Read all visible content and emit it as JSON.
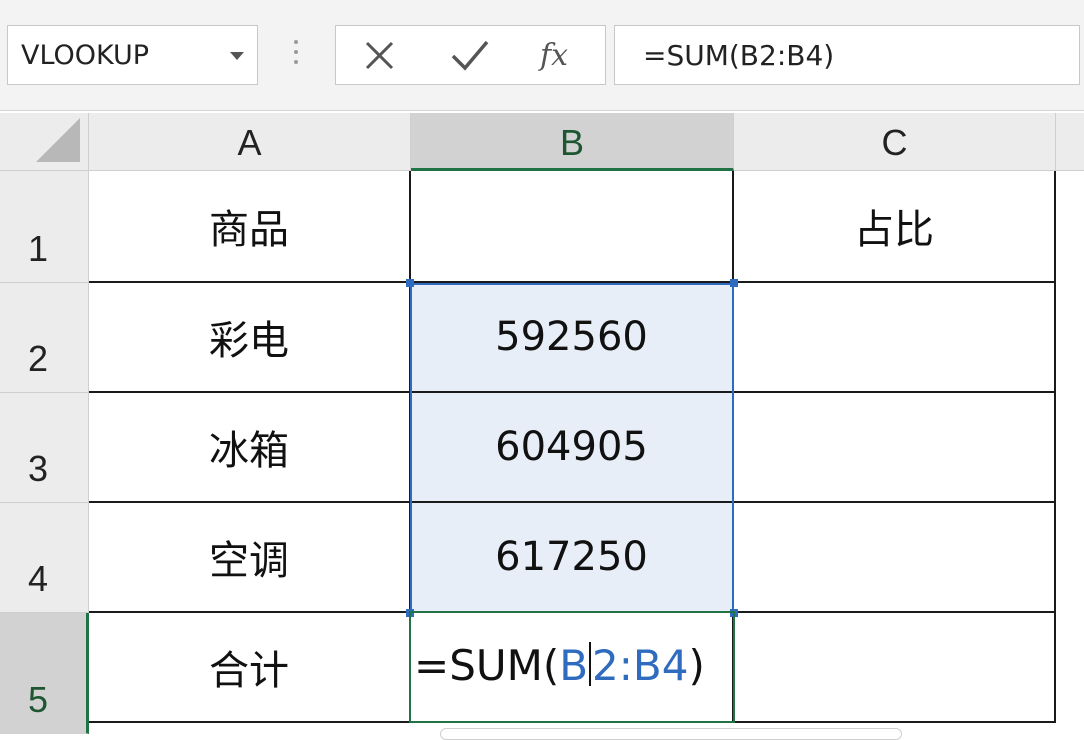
{
  "formula_bar": {
    "name_box": "VLOOKUP",
    "cancel_icon": "close-icon",
    "enter_icon": "check-icon",
    "function_label": "fx",
    "formula": "=SUM(B2:B4)"
  },
  "columns": [
    "A",
    "B",
    "C"
  ],
  "rows": [
    "1",
    "2",
    "3",
    "4",
    "5"
  ],
  "cells": {
    "A1": "商品",
    "B1": "",
    "C1": "占比",
    "A2": "彩电",
    "B2": "592560",
    "C2": "",
    "A3": "冰箱",
    "B3": "604905",
    "C3": "",
    "A4": "空调",
    "B4": "617250",
    "C4": "",
    "A5": "合计",
    "C5": ""
  },
  "edit_cell": {
    "prefix": "=SUM(",
    "ref_start": "B",
    "ref_rest": "2:B4",
    "suffix": ")"
  },
  "colors": {
    "range_highlight": "#2f6bbf",
    "active_cell": "#217346",
    "range_fill": "#e8eef8"
  }
}
